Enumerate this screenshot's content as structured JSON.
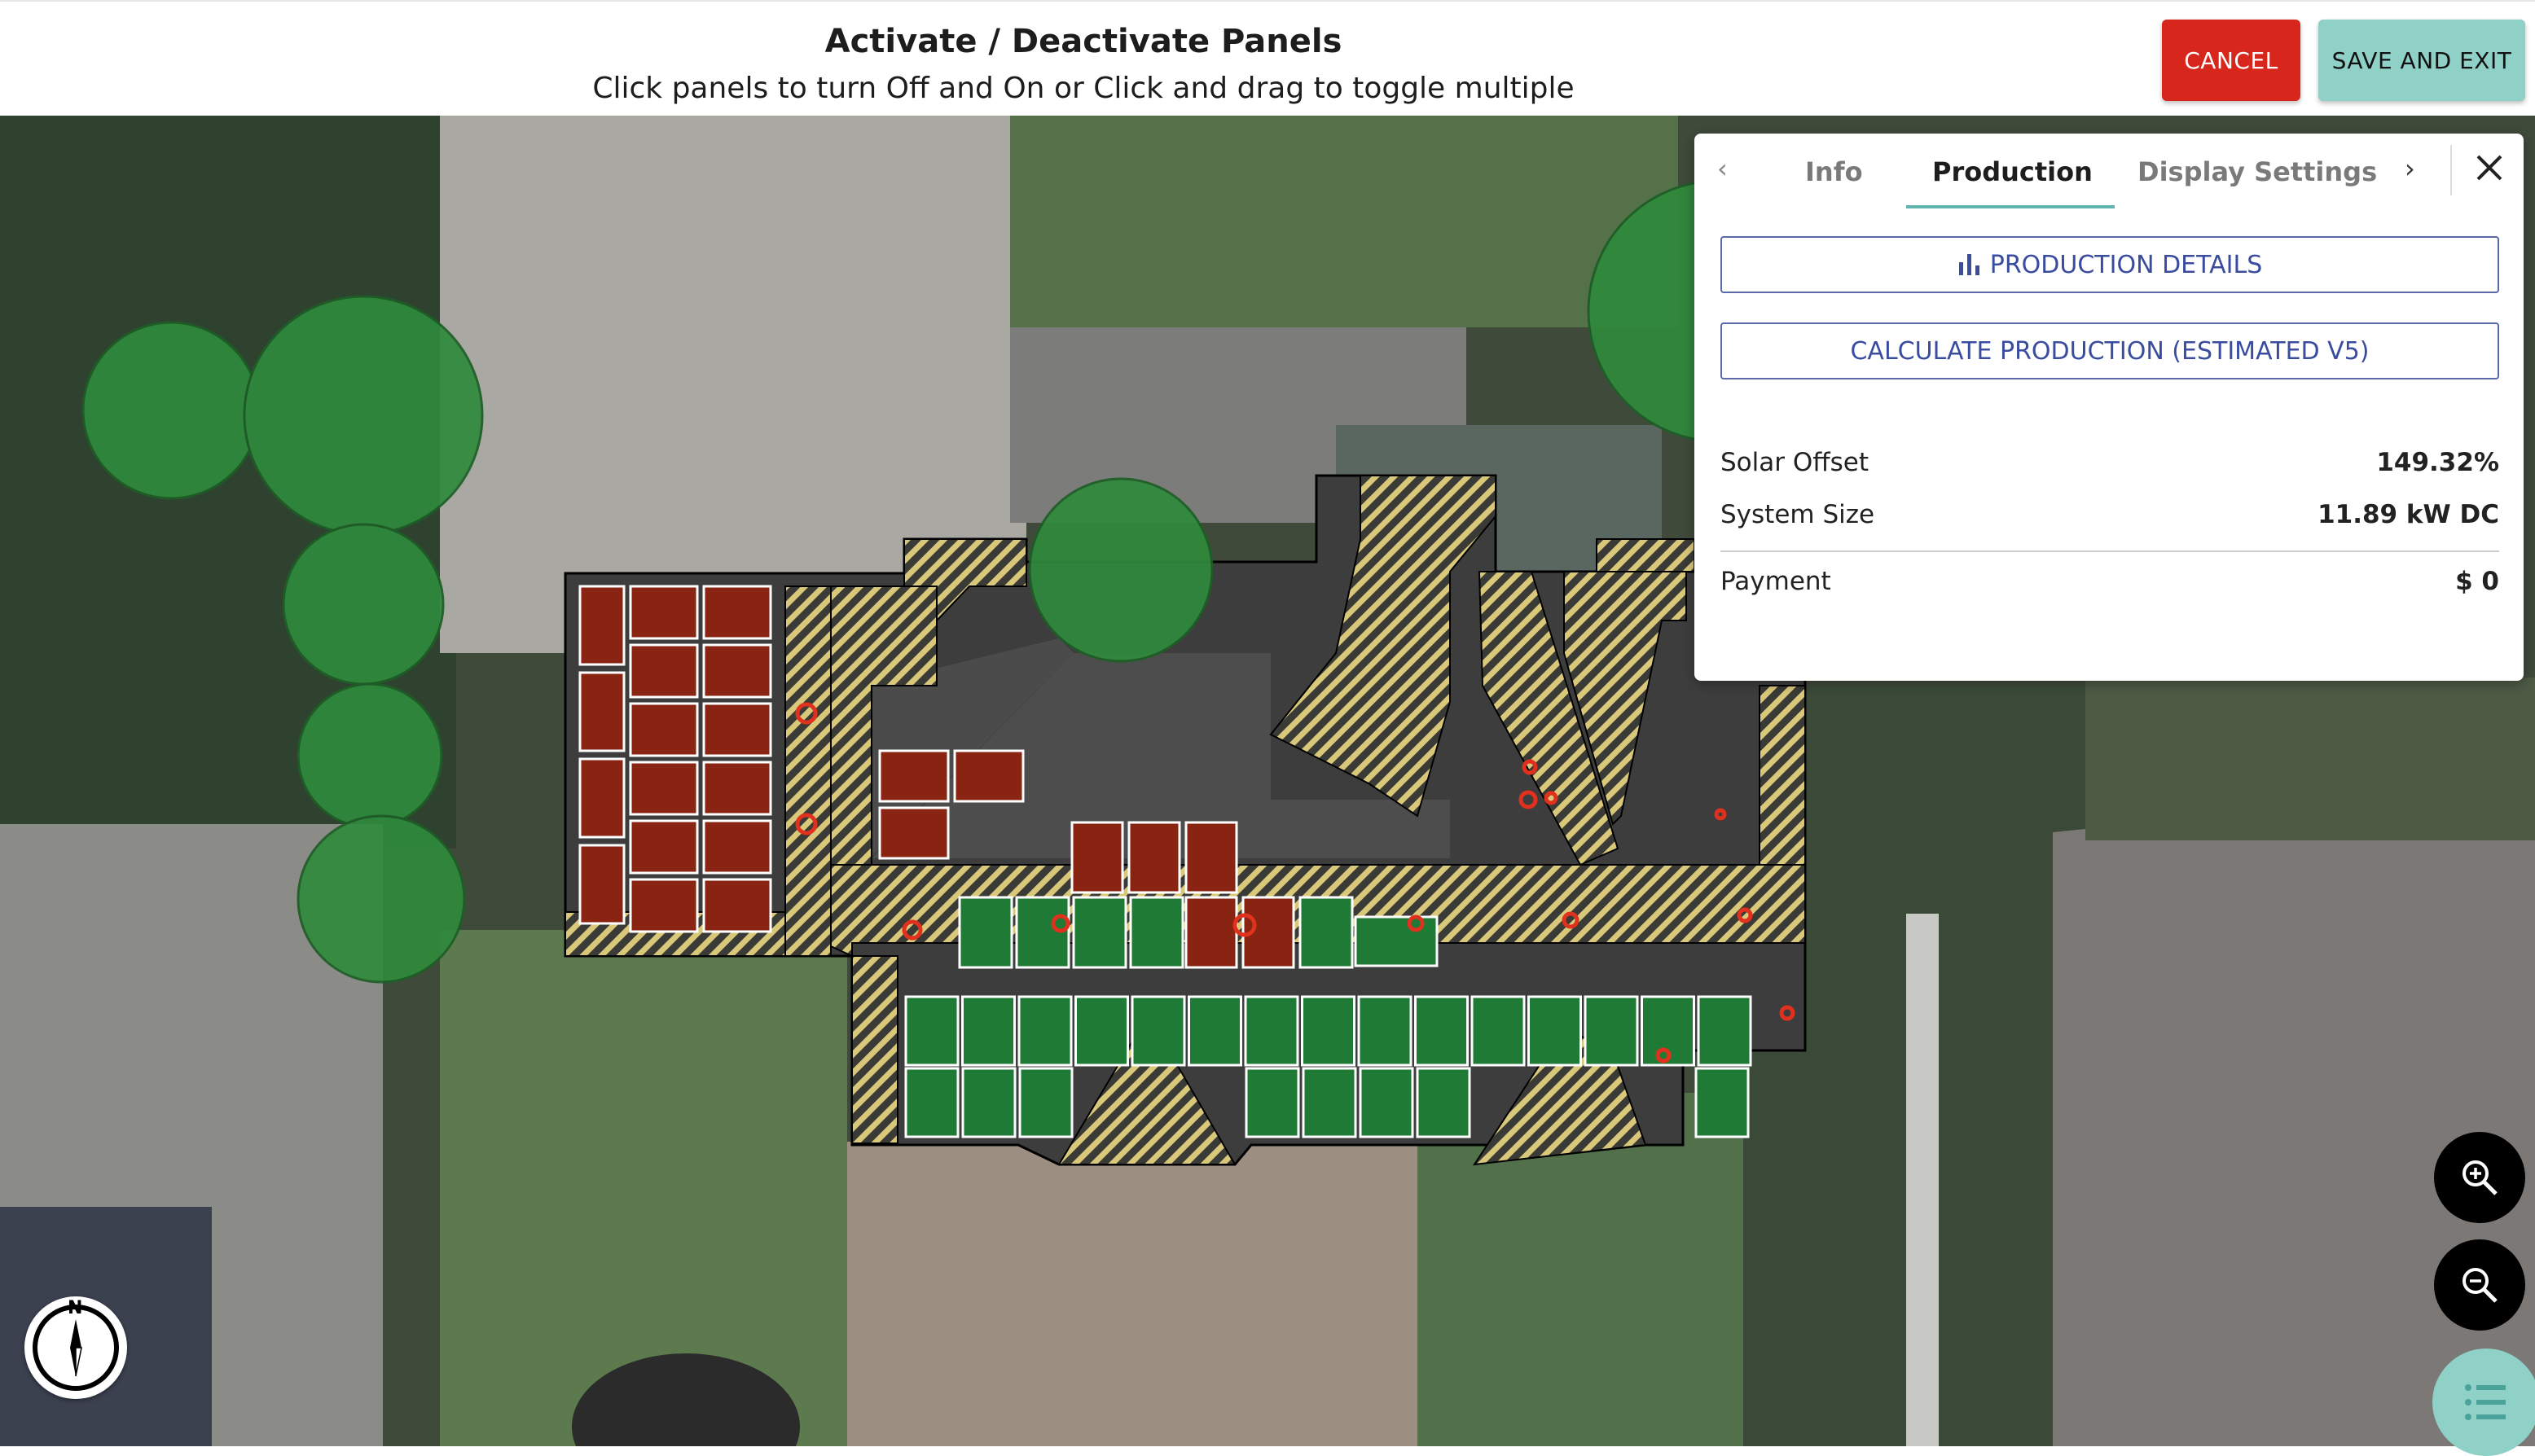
{
  "header": {
    "title": "Activate / Deactivate Panels",
    "subtitle": "Click panels to turn Off and On or Click and drag to toggle multiple",
    "cancel_label": "CANCEL",
    "save_label": "SAVE AND EXIT",
    "cancel_color": "#d7261c",
    "save_color": "#8fd0c7"
  },
  "side_panel": {
    "tabs": [
      "Info",
      "Production",
      "Display Settings"
    ],
    "active_tab": "Production",
    "production_details_label": "PRODUCTION DETAILS",
    "calculate_label": "CALCULATE PRODUCTION (ESTIMATED V5)",
    "stats": {
      "solar_offset_label": "Solar Offset",
      "solar_offset_value": "149.32%",
      "system_size_label": "System Size",
      "system_size_value": "11.89 kW DC",
      "payment_label": "Payment",
      "payment_value": "$ 0"
    }
  },
  "map": {
    "compass_label": "N",
    "colors": {
      "active_panel": "#1f7a35",
      "inactive_panel": "#8a2412",
      "tree": "#2f8a3c",
      "setback_hatch": "#d9c87a"
    }
  },
  "controls": {
    "zoom_in_icon": "zoom-in-icon",
    "zoom_out_icon": "zoom-out-icon",
    "list_icon": "list-icon"
  }
}
